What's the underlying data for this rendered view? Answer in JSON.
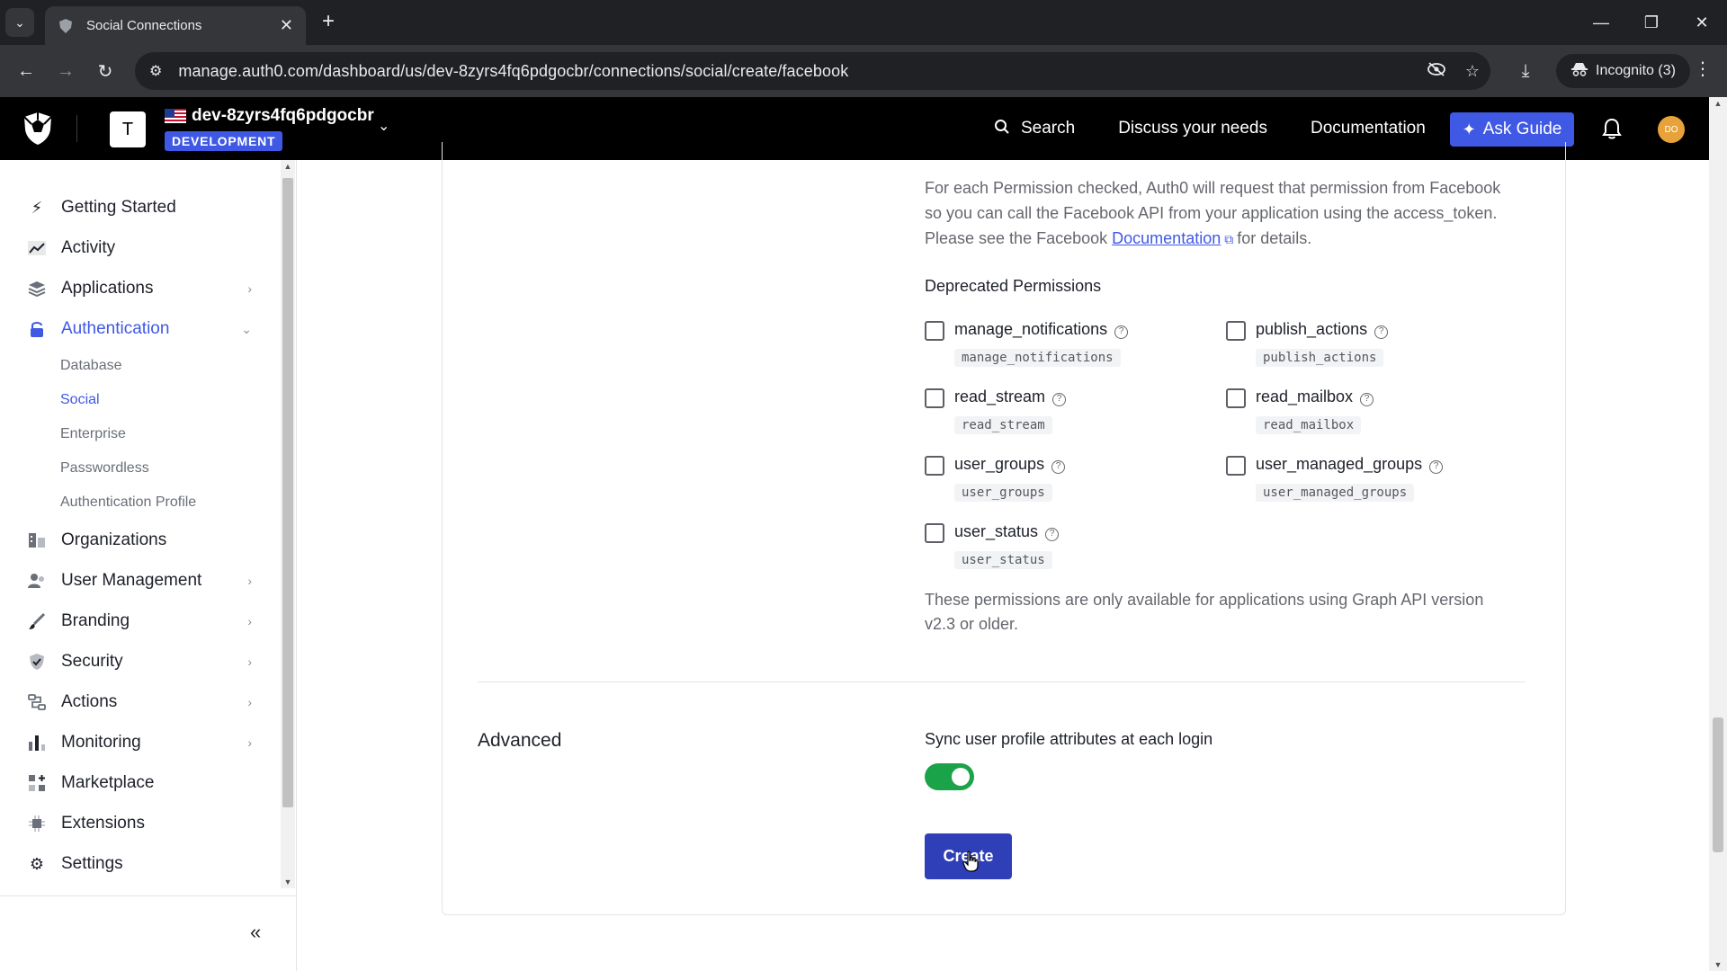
{
  "browser": {
    "tab_title": "Social Connections",
    "url": "manage.auth0.com/dashboard/us/dev-8zyrs4fq6pdgocbr/connections/social/create/facebook",
    "incognito_label": "Incognito (3)"
  },
  "header": {
    "tenant_initial": "T",
    "tenant_name": "dev-8zyrs4fq6pdgocbr",
    "environment": "DEVELOPMENT",
    "nav": {
      "search": "Search",
      "discuss": "Discuss your needs",
      "documentation": "Documentation"
    },
    "ask_guide": "Ask Guide",
    "user_initials": "DO",
    "accent_color": "#3f59e4"
  },
  "sidebar": {
    "items": [
      {
        "label": "Getting Started"
      },
      {
        "label": "Activity"
      },
      {
        "label": "Applications"
      },
      {
        "label": "Authentication"
      },
      {
        "label": "Organizations"
      },
      {
        "label": "User Management"
      },
      {
        "label": "Branding"
      },
      {
        "label": "Security"
      },
      {
        "label": "Actions"
      },
      {
        "label": "Monitoring"
      },
      {
        "label": "Marketplace"
      },
      {
        "label": "Extensions"
      },
      {
        "label": "Settings"
      }
    ],
    "auth_subitems": [
      {
        "label": "Database"
      },
      {
        "label": "Social"
      },
      {
        "label": "Enterprise"
      },
      {
        "label": "Passwordless"
      },
      {
        "label": "Authentication Profile"
      }
    ],
    "active_item": "Authentication",
    "active_subitem": "Social"
  },
  "main": {
    "intro_line1": "For each Permission checked, Auth0 will request that permission from Facebook",
    "intro_line2": "so you can call the Facebook API from your application using the access_token.",
    "intro_line3_prefix": "Please see the Facebook",
    "intro_link": "Documentation",
    "intro_line3_suffix": "for details.",
    "deprecated_title": "Deprecated Permissions",
    "permissions": [
      {
        "name": "manage_notifications",
        "code": "manage_notifications",
        "checked": false
      },
      {
        "name": "publish_actions",
        "code": "publish_actions",
        "checked": false
      },
      {
        "name": "read_stream",
        "code": "read_stream",
        "checked": false
      },
      {
        "name": "read_mailbox",
        "code": "read_mailbox",
        "checked": false
      },
      {
        "name": "user_groups",
        "code": "user_groups",
        "checked": false
      },
      {
        "name": "user_managed_groups",
        "code": "user_managed_groups",
        "checked": false
      },
      {
        "name": "user_status",
        "code": "user_status",
        "checked": false
      }
    ],
    "deprecated_note_line1": "These permissions are only available for applications using Graph API version",
    "deprecated_note_line2": "v2.3 or older.",
    "advanced_title": "Advanced",
    "sync_label": "Sync user profile attributes at each login",
    "sync_enabled": true,
    "toggle_color": "#1ba34a",
    "create_label": "Create",
    "create_color": "#2e3fb7"
  }
}
